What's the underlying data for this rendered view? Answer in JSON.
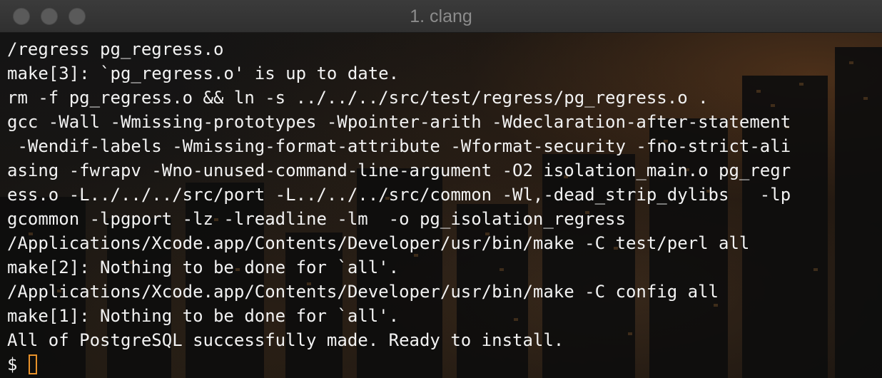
{
  "window": {
    "title": "1. clang"
  },
  "terminal": {
    "lines": [
      "/regress pg_regress.o",
      "make[3]: `pg_regress.o' is up to date.",
      "rm -f pg_regress.o && ln -s ../../../src/test/regress/pg_regress.o .",
      "gcc -Wall -Wmissing-prototypes -Wpointer-arith -Wdeclaration-after-statement",
      " -Wendif-labels -Wmissing-format-attribute -Wformat-security -fno-strict-ali",
      "asing -fwrapv -Wno-unused-command-line-argument -O2 isolation_main.o pg_regr",
      "ess.o -L../../../src/port -L../../../src/common -Wl,-dead_strip_dylibs   -lp",
      "gcommon -lpgport -lz -lreadline -lm  -o pg_isolation_regress",
      "/Applications/Xcode.app/Contents/Developer/usr/bin/make -C test/perl all",
      "make[2]: Nothing to be done for `all'.",
      "/Applications/Xcode.app/Contents/Developer/usr/bin/make -C config all",
      "make[1]: Nothing to be done for `all'.",
      "All of PostgreSQL successfully made. Ready to install."
    ],
    "prompt": "$",
    "cursor_color": "#e8922a",
    "text_color": "#f2f2f2"
  }
}
